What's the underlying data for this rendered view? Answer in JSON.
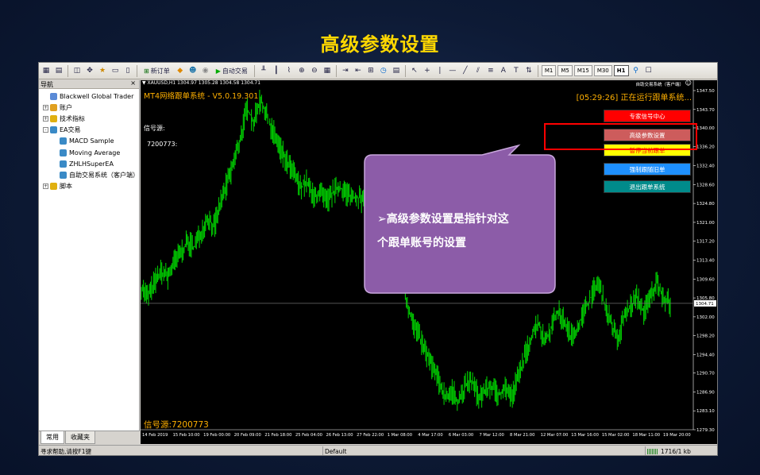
{
  "slide": {
    "title": "高级参数设置"
  },
  "toolbar": {
    "new_order": "新订单",
    "auto_trade": "自动交易",
    "timeframes": [
      "M1",
      "M5",
      "M15",
      "M30",
      "H1"
    ],
    "active_timeframe": "H1"
  },
  "navigator": {
    "title": "导航",
    "close": "×",
    "items": [
      {
        "label": "Blackwell Global Trader",
        "icon": "terminal-icon",
        "level": 0
      },
      {
        "label": "账户",
        "icon": "accounts-icon",
        "level": 0,
        "expander": "+"
      },
      {
        "label": "技术指标",
        "icon": "indicators-icon",
        "level": 0,
        "expander": "+"
      },
      {
        "label": "EA交易",
        "icon": "experts-icon",
        "level": 0,
        "expander": "-"
      },
      {
        "label": "MACD Sample",
        "icon": "expert-icon",
        "level": 1
      },
      {
        "label": "Moving Average",
        "icon": "expert-icon",
        "level": 1
      },
      {
        "label": "ZHLHSuperEA",
        "icon": "expert-icon",
        "level": 1
      },
      {
        "label": "自助交易系统（客户端）",
        "icon": "expert-icon",
        "level": 1
      },
      {
        "label": "脚本",
        "icon": "scripts-icon",
        "level": 0,
        "expander": "+"
      }
    ],
    "tabs": [
      "常用",
      "收藏夹"
    ],
    "active_tab": "常用"
  },
  "chart": {
    "symbol_line": "▼ XAUUSD,H1  1304.97 1305.28 1304.58 1304.71",
    "ea_name": "自助交易系统（客户端）",
    "smiley": "☺",
    "system_title": "MT4网络跟单系统 - V5.0.19.301",
    "status": "[05:29:26] 正在运行跟单系统...",
    "signal_label": "信号源:",
    "signal_number": "7200773:",
    "signal_bottom": "信号源:7200773",
    "current_price": "1304.71",
    "buttons": [
      {
        "label": "专家信号中心",
        "bg": "#ff0000",
        "fg": "#ffffff"
      },
      {
        "label": "高级参数设置",
        "bg": "#cd5c5c",
        "fg": "#ffffff"
      },
      {
        "label": "暂停当前跟单",
        "bg": "#ffff00",
        "fg": "#ff0000"
      },
      {
        "label": "强制跟随旧单",
        "bg": "#1e90ff",
        "fg": "#ffffff"
      },
      {
        "label": "退出跟单系统",
        "bg": "#008b8b",
        "fg": "#ffffff"
      }
    ],
    "y_axis_labels": [
      "1347.50",
      "1343.70",
      "1340.00",
      "1336.20",
      "1332.40",
      "1328.60",
      "1324.80",
      "1321.00",
      "1317.20",
      "1313.40",
      "1309.60",
      "1305.80",
      "1302.00",
      "1298.20",
      "1294.40",
      "1290.70",
      "1286.90",
      "1283.10",
      "1279.30"
    ],
    "x_axis_labels": [
      "14 Feb 2019",
      "15 Feb 10:00",
      "19 Feb 00:00",
      "20 Feb 09:00",
      "21 Feb 18:00",
      "25 Feb 04:00",
      "26 Feb 13:00",
      "27 Feb 22:00",
      "1 Mar 08:00",
      "4 Mar 17:00",
      "6 Mar 03:00",
      "7 Mar 12:00",
      "8 Mar 21:00",
      "12 Mar 07:00",
      "13 Mar 16:00",
      "15 Mar 02:00",
      "18 Mar 11:00",
      "19 Mar 20:00"
    ],
    "price_path": [
      1308,
      1306,
      1309,
      1311,
      1310,
      1313,
      1315,
      1317,
      1316,
      1319,
      1322,
      1320,
      1325,
      1329,
      1333,
      1338,
      1344,
      1341,
      1346,
      1342,
      1339,
      1336,
      1333,
      1331,
      1328,
      1329,
      1326,
      1327,
      1325,
      1327,
      1328,
      1327,
      1326,
      1326,
      1324,
      1325,
      1323,
      1321,
      1318,
      1312,
      1306,
      1301,
      1298,
      1295,
      1292,
      1289,
      1286,
      1287,
      1285,
      1288,
      1289,
      1286,
      1287,
      1288,
      1286,
      1288,
      1286,
      1290,
      1294,
      1298,
      1301,
      1297,
      1300,
      1303,
      1301,
      1298,
      1300,
      1303,
      1306,
      1309,
      1305,
      1301,
      1297,
      1302,
      1304,
      1306,
      1303,
      1306,
      1309,
      1306,
      1304.7
    ],
    "line_color": "#00c800",
    "price_line_color": "#6e6e6e"
  },
  "callout": {
    "lines": [
      "➢高级参数设置是指针对这",
      "个跟单账号的设置"
    ],
    "fill": "#8c5ca8"
  },
  "statusbar": {
    "help": "寻求帮助,请按F1键",
    "profile": "Default",
    "traffic": "1716/1 kb"
  }
}
